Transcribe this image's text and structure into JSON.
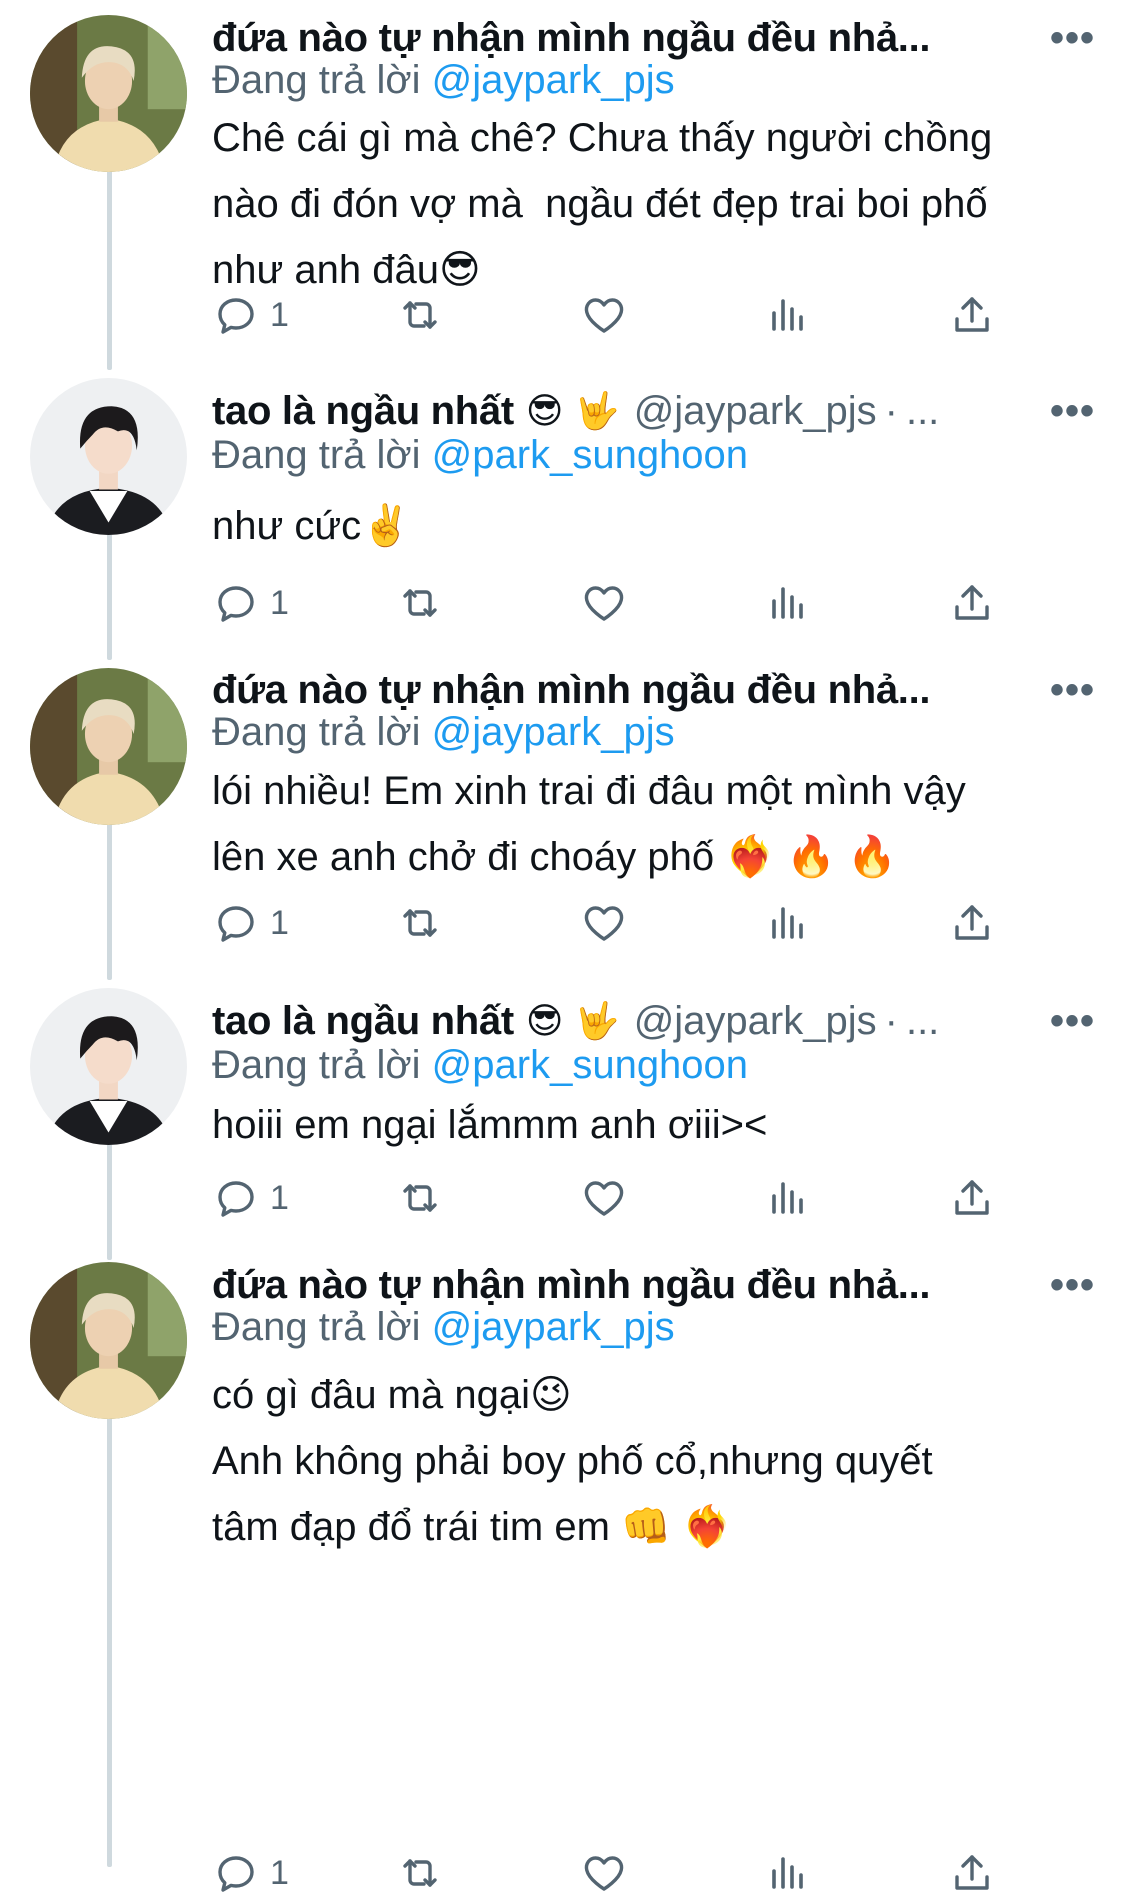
{
  "colors": {
    "accent": "#1d9bf0",
    "muted": "#536471",
    "text": "#0f1419",
    "thread": "#cfd9de"
  },
  "tweets": [
    {
      "name": "đứa nào tự nhận mình ngầu đều nhả...",
      "name_emojis": "",
      "handle": "",
      "replying_prefix": "Đang trả lời ",
      "replying_to": "@jaypark_pjs",
      "text": "Chê cái gì mà chê? Chưa thấy người chồng\nnào đi đón vợ mà  ngầu đét đẹp trai boi phố\nnhư anh đâu😎",
      "reply_count": "1",
      "avatar": "avatar-blond-beige-shirt"
    },
    {
      "name": "tao là ngầu nhất",
      "name_emojis": "😎 🤟",
      "handle": "@jaypark_pjs",
      "replying_prefix": "Đang trả lời ",
      "replying_to": "@park_sunghoon",
      "text": "như cức✌️",
      "reply_count": "1",
      "avatar": "avatar-dark-hair-black-jacket"
    },
    {
      "name": "đứa nào tự nhận mình ngầu đều nhả...",
      "name_emojis": "",
      "handle": "",
      "replying_prefix": "Đang trả lời ",
      "replying_to": "@jaypark_pjs",
      "text": "lói nhiều! Em xinh trai đi đâu một mình vậy\nlên xe anh chở đi choáy phố ❤️‍🔥 🔥 🔥",
      "reply_count": "1",
      "avatar": "avatar-blond-beige-shirt"
    },
    {
      "name": "tao là ngầu nhất",
      "name_emojis": "😎 🤟",
      "handle": "@jaypark_pjs",
      "replying_prefix": "Đang trả lời ",
      "replying_to": "@park_sunghoon",
      "text": "hoiii em ngại lắmmm anh ơiii><",
      "reply_count": "1",
      "avatar": "avatar-dark-hair-black-jacket"
    },
    {
      "name": "đứa nào tự nhận mình ngầu đều nhả...",
      "name_emojis": "",
      "handle": "",
      "replying_prefix": "Đang trả lời ",
      "replying_to": "@jaypark_pjs",
      "text": "có gì đâu mà ngại😉\nAnh không phải boy phố cổ,nhưng quyết\ntâm đạp đổ trái tim em 👊 ❤️‍🔥",
      "reply_count": "1",
      "avatar": "avatar-blond-beige-shirt"
    }
  ],
  "icons": {
    "reply": "reply-bubble-icon",
    "retweet": "retweet-icon",
    "like": "heart-icon",
    "views": "analytics-icon",
    "share": "share-icon",
    "more": "more-dots-icon"
  }
}
